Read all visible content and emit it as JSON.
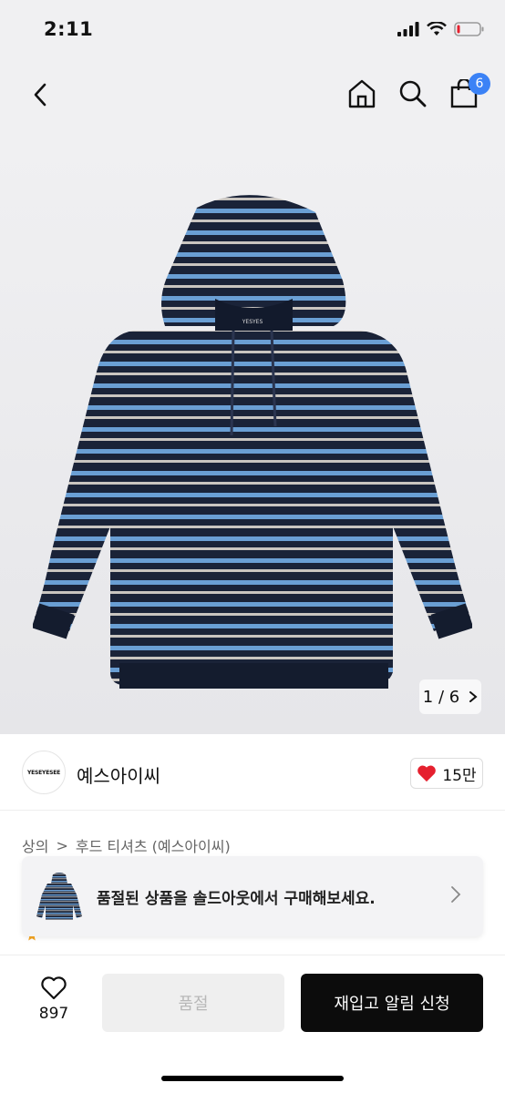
{
  "status": {
    "time": "2:11"
  },
  "nav": {
    "cart_count": "6",
    "back_icon": "chevron-left-icon",
    "home_icon": "home-icon",
    "search_icon": "search-icon",
    "cart_icon": "shopping-bag-icon"
  },
  "gallery": {
    "current": "1",
    "separator": "/",
    "total": "6"
  },
  "brand": {
    "logo_text": "YESEYESEE",
    "name": "예스아이씨",
    "likes": "15만"
  },
  "breadcrumb": {
    "category": "상의",
    "separator": ">",
    "subcategory": "후드 티셔츠 (예스아이씨)"
  },
  "banner": {
    "text": "품절된 상품을 솔드아웃에서 구매해보세요."
  },
  "bottom": {
    "wish_count": "897",
    "soldout_label": "품절",
    "restock_label": "재입고 알림 신청"
  },
  "colors": {
    "accent_blue": "#3b82f6",
    "heart_red": "#e5202e",
    "primary_black": "#0c0c0c"
  }
}
